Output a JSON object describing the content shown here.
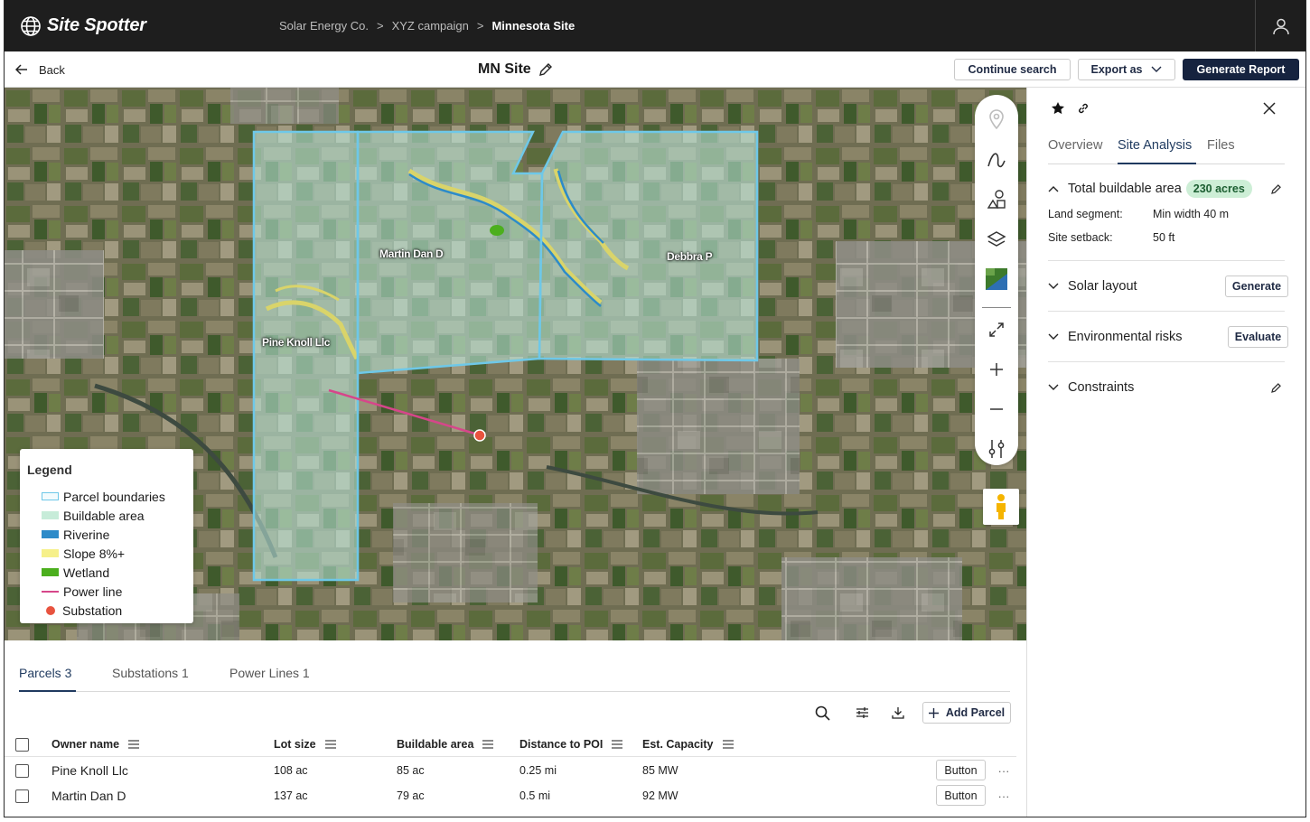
{
  "app": {
    "name": "Site Spotter"
  },
  "breadcrumb": [
    "Solar Energy Co.",
    "XYZ campaign",
    "Minnesota Site"
  ],
  "breadcrumb_separator": ">",
  "header": {
    "back_label": "Back",
    "site_title": "MN Site",
    "continue_search_label": "Continue search",
    "export_label": "Export as",
    "generate_report_label": "Generate Report"
  },
  "map": {
    "parcel_labels": [
      "Martin Dan D",
      "Debbra P",
      "Pine Knoll Llc"
    ]
  },
  "legend": {
    "title": "Legend",
    "items": [
      {
        "label": "Parcel boundaries",
        "color": "#e6f6fb",
        "style": "outline"
      },
      {
        "label": "Buildable area",
        "color": "#c7ecd9",
        "style": "fill"
      },
      {
        "label": "Riverine",
        "color": "#2d8bc9",
        "style": "fill"
      },
      {
        "label": "Slope 8%+",
        "color": "#f6f08a",
        "style": "fill"
      },
      {
        "label": "Wetland",
        "color": "#4caf1e",
        "style": "fill"
      },
      {
        "label": "Power line",
        "color": "#d6468a",
        "style": "line"
      },
      {
        "label": "Substation",
        "color": "#e8533f",
        "style": "dot"
      }
    ]
  },
  "map_tools": [
    "pin-icon",
    "draw-line-icon",
    "shapes-icon",
    "layers-icon",
    "satellite-thumbnail",
    "expand-icon",
    "zoom-in-icon",
    "zoom-out-icon",
    "sliders-icon"
  ],
  "bottom_tabs": [
    {
      "label": "Parcels 3",
      "active": true
    },
    {
      "label": "Substations 1",
      "active": false
    },
    {
      "label": "Power Lines 1",
      "active": false
    }
  ],
  "table": {
    "add_label": "Add Parcel",
    "columns": [
      "Owner name",
      "Lot size",
      "Buildable area",
      "Distance to POI",
      "Est. Capacity"
    ],
    "rows": [
      {
        "owner": "Pine Knoll Llc",
        "lot_size": "108 ac",
        "buildable": "85 ac",
        "distance": "0.25 mi",
        "capacity": "85 MW",
        "action": "Button",
        "more": "···"
      },
      {
        "owner": "Martin Dan D",
        "lot_size": "137 ac",
        "buildable": "79 ac",
        "distance": "0.5 mi",
        "capacity": "92 MW",
        "action": "Button",
        "more": "···"
      }
    ]
  },
  "panel": {
    "tabs": [
      {
        "label": "Overview",
        "active": false
      },
      {
        "label": "Site Analysis",
        "active": true
      },
      {
        "label": "Files",
        "active": false
      }
    ],
    "buildable": {
      "title": "Total buildable area",
      "badge": "230 acres",
      "land_segment_label": "Land segment:",
      "land_segment_value": "Min width 40 m",
      "setback_label": "Site setback:",
      "setback_value": "50 ft"
    },
    "solar_layout": {
      "title": "Solar layout",
      "button": "Generate"
    },
    "env_risks": {
      "title": "Environmental risks",
      "button": "Evaluate"
    },
    "constraints": {
      "title": "Constraints"
    }
  }
}
